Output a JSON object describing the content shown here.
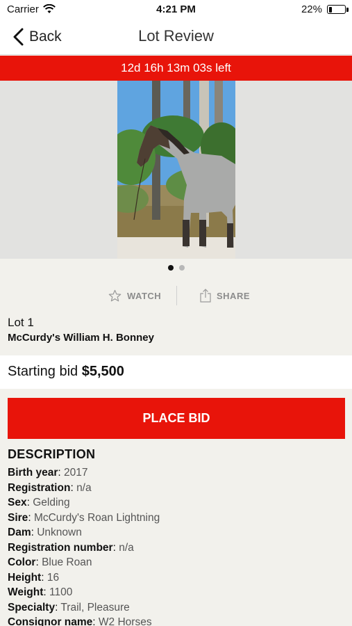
{
  "status_bar": {
    "carrier": "Carrier",
    "time": "4:21 PM",
    "battery": "22%",
    "battery_level": 0.22
  },
  "nav": {
    "back_label": "Back",
    "title": "Lot Review"
  },
  "timer": {
    "text": "12d 16h 13m 03s left"
  },
  "gallery": {
    "image_count": 2,
    "active_index": 0
  },
  "actions": {
    "watch_label": "WATCH",
    "share_label": "SHARE"
  },
  "lot": {
    "number": "Lot 1",
    "name": "McCurdy's William H. Bonney"
  },
  "bid": {
    "label": "Starting bid",
    "amount": "$5,500"
  },
  "place_bid_label": "PLACE BID",
  "description": {
    "heading": "DESCRIPTION",
    "items": [
      {
        "key": "Birth year",
        "value": "2017"
      },
      {
        "key": "Registration",
        "value": "n/a"
      },
      {
        "key": "Sex",
        "value": "Gelding"
      },
      {
        "key": "Sire",
        "value": "McCurdy's Roan Lightning"
      },
      {
        "key": "Dam",
        "value": "Unknown"
      },
      {
        "key": "Registration number",
        "value": "n/a"
      },
      {
        "key": "Color",
        "value": "Blue Roan"
      },
      {
        "key": "Height",
        "value": "16"
      },
      {
        "key": "Weight",
        "value": "1100"
      },
      {
        "key": "Specialty",
        "value": "Trail, Pleasure"
      },
      {
        "key": "Consignor name",
        "value": "W2 Horses"
      }
    ]
  },
  "colors": {
    "accent": "#e8140a",
    "background": "#f2f1ec"
  }
}
